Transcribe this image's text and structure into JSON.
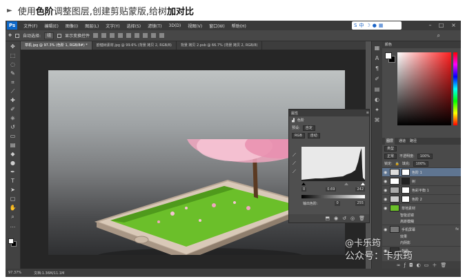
{
  "caption": {
    "prefix": "使用",
    "bold1": "色阶",
    "middle": "调整图层,创建剪贴蒙版,给树",
    "bold2": "加对比"
  },
  "app": {
    "logo": "Ps",
    "menu": [
      "文件(F)",
      "编辑(E)",
      "图像(I)",
      "图层(L)",
      "文字(Y)",
      "选择(S)",
      "滤镜(T)",
      "3D(D)",
      "视图(V)",
      "窗口(W)",
      "帮助(H)"
    ],
    "ime_label": "中"
  },
  "options_bar": {
    "auto_select": "自动选择:",
    "auto_select_value": "组",
    "show_transform": "显示变换控件"
  },
  "tabs": [
    {
      "label": "草机.jpg @ 97.3% (色阶 1, RGB/8#) *",
      "active": true
    },
    {
      "label": "欧健树素材.jpg @ 99.6% (背景 拷贝 2, RGB/8)",
      "active": false
    },
    {
      "label": "背景 拷贝 2.psb @ 66.7% (背景 拷贝 2, RGB/8)",
      "active": false
    }
  ],
  "status": {
    "zoom": "97.37%",
    "doc": "文档:1.36M/11.1M"
  },
  "levels_panel": {
    "title": "属性",
    "subtitle": "色阶",
    "preset_label": "预设:",
    "preset_value": "自定",
    "channel": "RGB",
    "auto": "自动",
    "input_black": "0",
    "input_gamma": "0.69",
    "input_white": "242",
    "output_label": "输出色阶:",
    "output_black": "0",
    "output_white": "255"
  },
  "color_panel": {
    "title": "颜色"
  },
  "layers_panel": {
    "tabs": [
      "图层",
      "通道",
      "路径"
    ],
    "kind": "类型",
    "blend": "正常",
    "opacity_label": "不透明度:",
    "opacity": "100%",
    "lock_label": "锁定:",
    "fill_label": "填充:",
    "fill": "100%",
    "layers": [
      {
        "name": "色阶 1",
        "selected": true,
        "sub": false,
        "fx": ""
      },
      {
        "name": "树",
        "selected": false,
        "sub": false,
        "fx": ""
      },
      {
        "name": "色彩平衡 1",
        "selected": false,
        "sub": false,
        "fx": ""
      },
      {
        "name": "色阶 2",
        "selected": false,
        "sub": false,
        "fx": ""
      },
      {
        "name": "草地素材",
        "selected": false,
        "sub": false,
        "fx": ""
      },
      {
        "name": "智能滤镜",
        "selected": false,
        "sub": true,
        "fx": ""
      },
      {
        "name": "高斯模糊",
        "selected": false,
        "sub": true,
        "fx": ""
      },
      {
        "name": "手机屏幕",
        "selected": false,
        "sub": false,
        "fx": "fx"
      },
      {
        "name": "效果",
        "selected": false,
        "sub": true,
        "fx": ""
      },
      {
        "name": "内阴影",
        "selected": false,
        "sub": true,
        "fx": ""
      },
      {
        "name": "背景",
        "selected": false,
        "sub": false,
        "fx": ""
      }
    ]
  },
  "watermark": {
    "line1": "@卡乐筠",
    "line2": "公众号：卡乐筠"
  },
  "colors": {
    "ps_dark": "#3a3a3a",
    "ps_mid": "#535353",
    "selection": "#5f7591",
    "grass": "#6bbf2a",
    "blossom": "#f1a7c0"
  }
}
